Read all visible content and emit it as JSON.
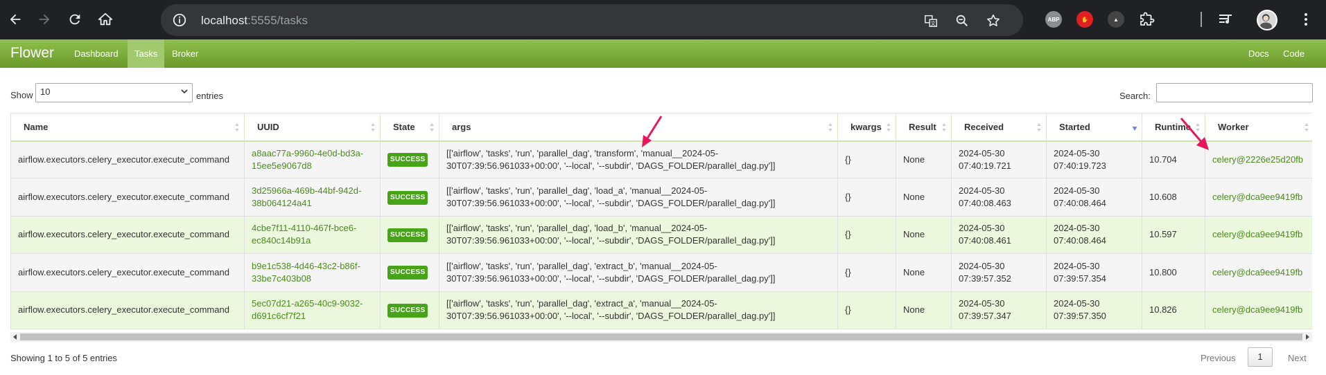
{
  "browser": {
    "url_host": "localhost",
    "url_rest": ":5555/tasks",
    "extensions": [
      {
        "name": "ABP",
        "color": "#8a8d91"
      },
      {
        "name": "block",
        "color": "#e02020"
      },
      {
        "name": "a",
        "color": "#555"
      }
    ]
  },
  "navbar": {
    "brand": "Flower",
    "items": [
      {
        "label": "Dashboard",
        "active": false
      },
      {
        "label": "Tasks",
        "active": true
      },
      {
        "label": "Broker",
        "active": false
      }
    ],
    "right_items": [
      {
        "label": "Docs"
      },
      {
        "label": "Code"
      }
    ]
  },
  "controls": {
    "show_label": "Show",
    "page_size": "10",
    "entries_label": "entries",
    "search_label": "Search:",
    "search_value": ""
  },
  "table": {
    "columns": [
      "Name",
      "UUID",
      "State",
      "args",
      "kwargs",
      "Result",
      "Received",
      "Started",
      "Runtime",
      "Worker"
    ],
    "sorted_column": "Started",
    "rows": [
      {
        "name": "airflow.executors.celery_executor.execute_command",
        "uuid_1": "a8aac77a-9960-4e0d-bd3a-",
        "uuid_2": "15ee5e9067d8",
        "state": "SUCCESS",
        "args_1": "[['airflow', 'tasks', 'run', 'parallel_dag', 'transform', 'manual__2024-05-",
        "args_2": "30T07:39:56.961033+00:00', '--local', '--subdir', 'DAGS_FOLDER/parallel_dag.py']]",
        "kwargs": "{}",
        "result": "None",
        "received_1": "2024-05-30",
        "received_2": "07:40:19.721",
        "started_1": "2024-05-30",
        "started_2": "07:40:19.723",
        "runtime": "10.704",
        "worker": "celery@2226e25d20fb"
      },
      {
        "name": "airflow.executors.celery_executor.execute_command",
        "uuid_1": "3d25966a-469b-44bf-942d-",
        "uuid_2": "38b064124a41",
        "state": "SUCCESS",
        "args_1": "[['airflow', 'tasks', 'run', 'parallel_dag', 'load_a', 'manual__2024-05-",
        "args_2": "30T07:39:56.961033+00:00', '--local', '--subdir', 'DAGS_FOLDER/parallel_dag.py']]",
        "kwargs": "{}",
        "result": "None",
        "received_1": "2024-05-30",
        "received_2": "07:40:08.463",
        "started_1": "2024-05-30",
        "started_2": "07:40:08.464",
        "runtime": "10.608",
        "worker": "celery@dca9ee9419fb"
      },
      {
        "name": "airflow.executors.celery_executor.execute_command",
        "uuid_1": "4cbe7f11-4110-467f-bce6-",
        "uuid_2": "ec840c14b91a",
        "state": "SUCCESS",
        "args_1": "[['airflow', 'tasks', 'run', 'parallel_dag', 'load_b', 'manual__2024-05-",
        "args_2": "30T07:39:56.961033+00:00', '--local', '--subdir', 'DAGS_FOLDER/parallel_dag.py']]",
        "kwargs": "{}",
        "result": "None",
        "received_1": "2024-05-30",
        "received_2": "07:40:08.461",
        "started_1": "2024-05-30",
        "started_2": "07:40:08.464",
        "runtime": "10.597",
        "worker": "celery@dca9ee9419fb"
      },
      {
        "name": "airflow.executors.celery_executor.execute_command",
        "uuid_1": "b9e1c538-4d46-43c2-b86f-",
        "uuid_2": "33be7c403b08",
        "state": "SUCCESS",
        "args_1": "[['airflow', 'tasks', 'run', 'parallel_dag', 'extract_b', 'manual__2024-05-",
        "args_2": "30T07:39:56.961033+00:00', '--local', '--subdir', 'DAGS_FOLDER/parallel_dag.py']]",
        "kwargs": "{}",
        "result": "None",
        "received_1": "2024-05-30",
        "received_2": "07:39:57.352",
        "started_1": "2024-05-30",
        "started_2": "07:39:57.354",
        "runtime": "10.800",
        "worker": "celery@dca9ee9419fb"
      },
      {
        "name": "airflow.executors.celery_executor.execute_command",
        "uuid_1": "5ec07d21-a265-40c9-9032-",
        "uuid_2": "d691c6cf7f21",
        "state": "SUCCESS",
        "args_1": "[['airflow', 'tasks', 'run', 'parallel_dag', 'extract_a', 'manual__2024-05-",
        "args_2": "30T07:39:56.961033+00:00', '--local', '--subdir', 'DAGS_FOLDER/parallel_dag.py']]",
        "kwargs": "{}",
        "result": "None",
        "received_1": "2024-05-30",
        "received_2": "07:39:57.347",
        "started_1": "2024-05-30",
        "started_2": "07:39:57.350",
        "runtime": "10.826",
        "worker": "celery@dca9ee9419fb"
      }
    ]
  },
  "footer": {
    "info": "Showing 1 to 5 of 5 entries",
    "previous": "Previous",
    "page": "1",
    "next": "Next"
  },
  "colors": {
    "navbar_top": "#8fbf4d",
    "navbar_bottom": "#6a9a2b",
    "link_green": "#4a8a1c",
    "badge_green": "#47a418",
    "annotation_arrow": "#e8175d"
  }
}
